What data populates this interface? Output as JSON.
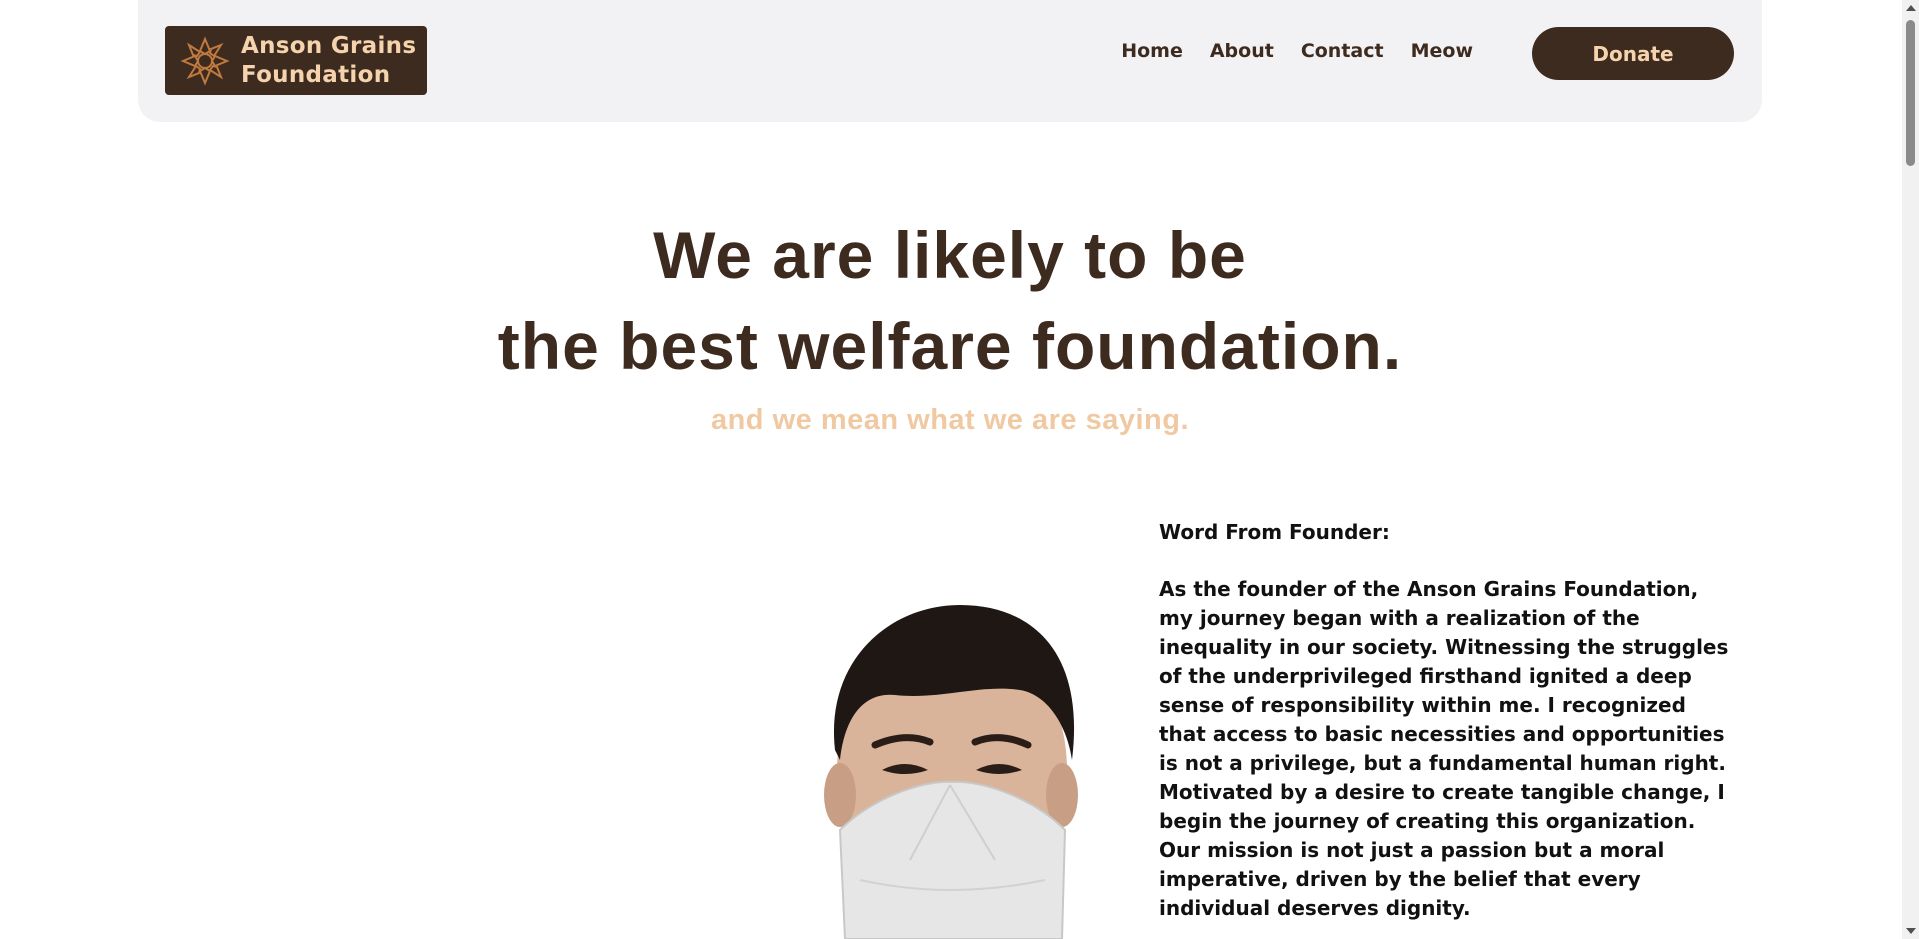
{
  "brand": {
    "name_line1": "Anson Grains",
    "name_line2": "Foundation",
    "logo_icon": "sun-mandala-icon"
  },
  "nav": {
    "items": [
      "Home",
      "About",
      "Contact",
      "Meow"
    ],
    "donate_label": "Donate"
  },
  "hero": {
    "title_line1": "We are likely to be",
    "title_line2": "the best welfare foundation.",
    "tagline": "and we mean what we are saying."
  },
  "founder": {
    "heading": "Word From Founder:",
    "body": "As the founder of the Anson Grains Foundation, my journey began with a realization of the inequality in our society. Witnessing the struggles of the underprivileged firsthand ignited a deep sense of responsibility within me. I recognized that access to basic necessities and opportunities is not a privilege, but a fundamental human right. Motivated by a desire to create tangible change, I begin the journey of creating this organization. Our mission is not just a passion but a moral imperative, driven by the belief that every individual deserves dignity."
  },
  "colors": {
    "brand_brown": "#3e2b1f",
    "brand_tan": "#f4d3ad",
    "tagline_tan": "#f0c9a3",
    "header_bg": "#f2f2f4"
  }
}
